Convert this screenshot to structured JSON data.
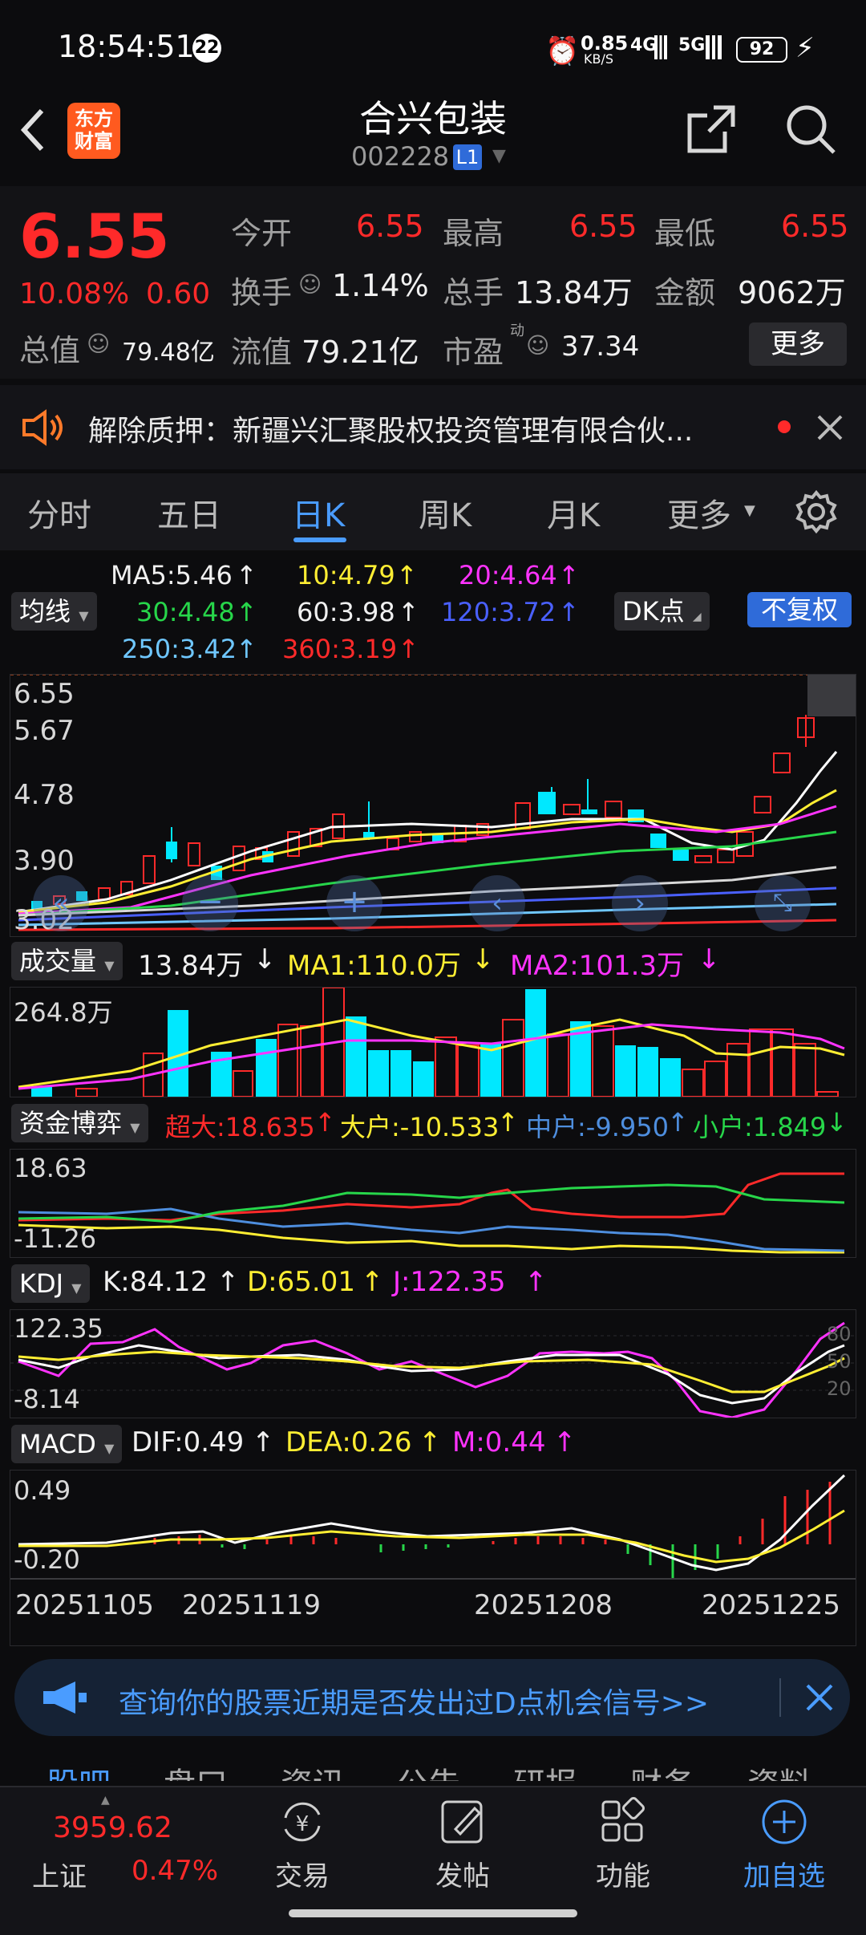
{
  "status_bar": {
    "time": "18:54:51",
    "badge": "22",
    "net_speed": "0.85",
    "net_unit": "KB/S",
    "sig1": "4G",
    "sig2": "5G",
    "battery": "92"
  },
  "header": {
    "logo_line1": "东方",
    "logo_line2": "财富",
    "title": "合兴包装",
    "code": "002228",
    "level": "L1"
  },
  "quote": {
    "price": "6.55",
    "change_pct": "10.08%",
    "change_abs": "0.60",
    "total_value_label": "总值",
    "total_value": "79.48亿",
    "open_label": "今开",
    "open": "6.55",
    "high_label": "最高",
    "high": "6.55",
    "low_label": "最低",
    "low": "6.55",
    "turnover_label": "换手",
    "turnover": "1.14%",
    "volume_label": "总手",
    "volume": "13.84万",
    "amount_label": "金额",
    "amount": "9062万",
    "float_value_label": "流值",
    "float_value": "79.21亿",
    "pe_label": "市盈",
    "pe_sup": "动",
    "pe": "37.34",
    "more_button": "更多"
  },
  "notice": {
    "text": "解除质押：新疆兴汇聚股权投资管理有限合伙..."
  },
  "tabs": [
    "分时",
    "五日",
    "日K",
    "周K",
    "月K",
    "更多"
  ],
  "active_tab": "日K",
  "ma_legend": {
    "ma5": "MA5:5.46",
    "ma10": "10:4.79",
    "ma20": "20:4.64",
    "ma30": "30:4.48",
    "ma60": "60:3.98",
    "ma120": "120:3.72",
    "ma250": "250:3.42",
    "ma360": "360:3.19",
    "indicator_dropdown": "均线",
    "dk_dropdown": "DK点",
    "adjust_button": "不复权"
  },
  "kline": {
    "y_labels": [
      "6.55",
      "5.67",
      "4.78",
      "3.90",
      "3.02"
    ]
  },
  "volume": {
    "dropdown": "成交量",
    "value": "13.84万",
    "ma1": "MA1:110.0万",
    "ma2": "MA2:101.3万",
    "y_label": "264.8万"
  },
  "capital": {
    "dropdown": "资金博弈",
    "super": "超大:18.635",
    "large": "大户:-10.533",
    "medium": "中户:-9.950",
    "small": "小户:1.849",
    "y_top": "18.63",
    "y_bottom": "-11.26"
  },
  "kdj": {
    "dropdown": "KDJ",
    "k": "K:84.12",
    "d": "D:65.01",
    "j": "J:122.35",
    "y_top": "122.35",
    "y_bottom": "-8.14",
    "levels": [
      "80",
      "50",
      "20"
    ]
  },
  "macd": {
    "dropdown": "MACD",
    "dif": "DIF:0.49",
    "dea": "DEA:0.26",
    "m": "M:0.44",
    "y_top": "0.49",
    "y_bottom": "-0.20"
  },
  "x_axis": [
    "20251105",
    "20251119",
    "20251208",
    "20251225"
  ],
  "dpoint_banner": "查询你的股票近期是否发出过D点机会信号>>",
  "peek_tabs": [
    "股吧",
    "盘口",
    "资讯",
    "公告",
    "研报",
    "财务",
    "资料"
  ],
  "bottom_nav": {
    "index_value": "3959.62",
    "index_name": "上证",
    "index_change": "0.47%",
    "items": [
      "交易",
      "发帖",
      "功能",
      "加自选"
    ]
  },
  "colors": {
    "up": "#ff2a2a",
    "down": "#00e8ff",
    "accent": "#4a9cff",
    "brand": "#ff5a1f"
  }
}
